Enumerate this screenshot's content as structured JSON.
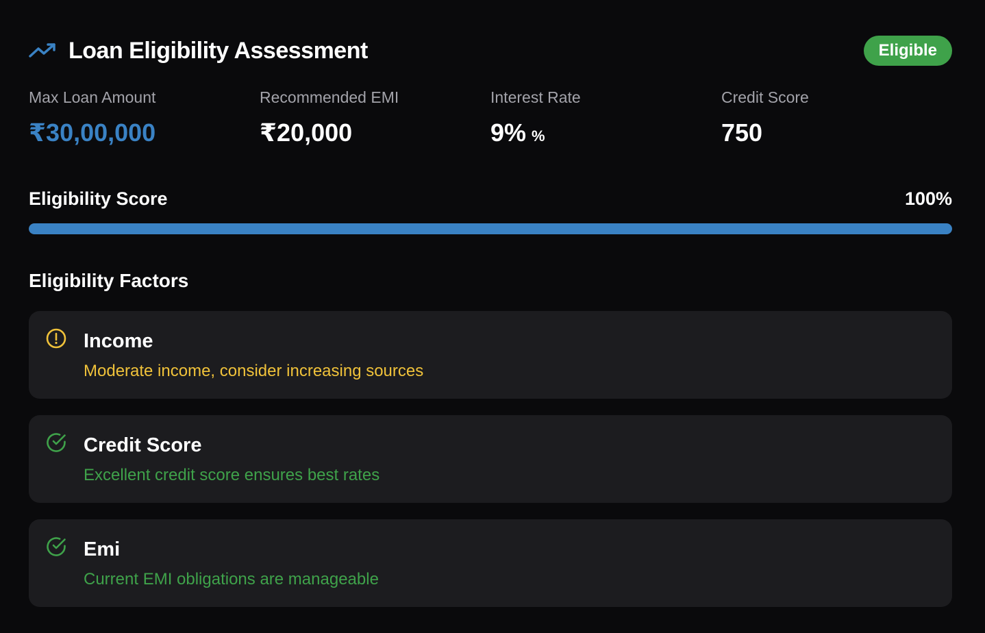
{
  "header": {
    "title": "Loan Eligibility Assessment",
    "status": "Eligible",
    "icon": "trending-up-icon",
    "accent_color": "#3a82c4",
    "status_color": "#3fa24a"
  },
  "stats": [
    {
      "label": "Max Loan Amount",
      "value": "₹30,00,000"
    },
    {
      "label": "Recommended EMI",
      "value": "₹20,000"
    },
    {
      "label": "Interest Rate",
      "value": "9%",
      "suffix": "%"
    },
    {
      "label": "Credit Score",
      "value": "750"
    }
  ],
  "score": {
    "label": "Eligibility Score",
    "value_text": "100%",
    "percent": 100
  },
  "factors_title": "Eligibility Factors",
  "factors": [
    {
      "name": "Income",
      "description": "Moderate income, consider increasing sources",
      "icon": "alert-circle-icon",
      "color": "#f0c23a"
    },
    {
      "name": "Credit Score",
      "description": "Excellent credit score ensures best rates",
      "icon": "check-circle-icon",
      "color": "#3fa24a"
    },
    {
      "name": "Emi",
      "description": "Current EMI obligations are manageable",
      "icon": "check-circle-icon",
      "color": "#3fa24a"
    }
  ]
}
